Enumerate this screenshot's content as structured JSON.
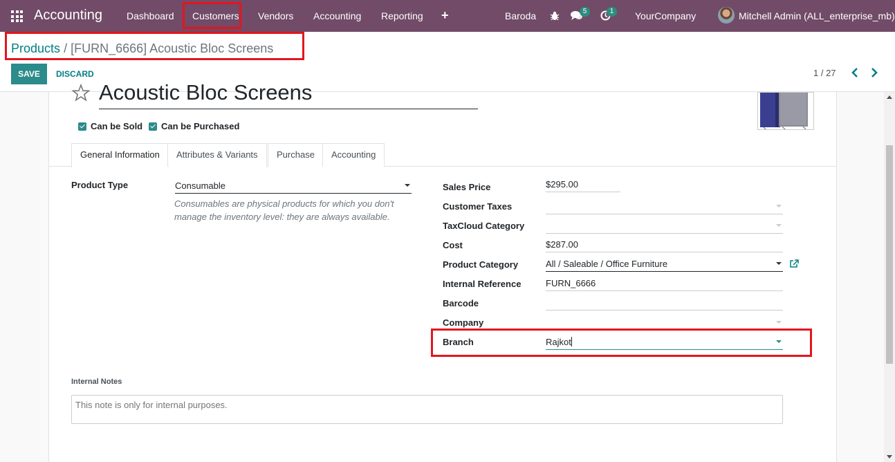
{
  "navbar": {
    "brand": "Accounting",
    "menu": [
      "Dashboard",
      "Customers",
      "Vendors",
      "Accounting",
      "Reporting"
    ],
    "branch": "Baroda",
    "messages_count": "5",
    "activities_count": "1",
    "company": "YourCompany",
    "user": "Mitchell Admin (ALL_enterprise_mb)"
  },
  "breadcrumb": {
    "parent": "Products",
    "separator": "/",
    "current": "[FURN_6666] Acoustic Bloc Screens"
  },
  "actions": {
    "save": "SAVE",
    "discard": "DISCARD"
  },
  "pager": {
    "value": "1 / 27"
  },
  "product": {
    "name": "Acoustic Bloc Screens",
    "can_be_sold": "Can be Sold",
    "can_be_purchased": "Can be Purchased"
  },
  "tabs": [
    "General Information",
    "Attributes & Variants",
    "Purchase",
    "Accounting"
  ],
  "general": {
    "product_type_label": "Product Type",
    "product_type_value": "Consumable",
    "product_type_help": "Consumables are physical products for which you don't manage the inventory level: they are always available.",
    "fields": {
      "sales_price": {
        "label": "Sales Price",
        "value": "$295.00"
      },
      "customer_taxes": {
        "label": "Customer Taxes",
        "value": ""
      },
      "taxcloud_category": {
        "label": "TaxCloud Category",
        "value": ""
      },
      "cost": {
        "label": "Cost",
        "value": "$287.00"
      },
      "product_category": {
        "label": "Product Category",
        "value": "All / Saleable / Office Furniture"
      },
      "internal_reference": {
        "label": "Internal Reference",
        "value": "FURN_6666"
      },
      "barcode": {
        "label": "Barcode",
        "value": ""
      },
      "company": {
        "label": "Company",
        "value": ""
      },
      "branch": {
        "label": "Branch",
        "value": "Rajkot"
      }
    }
  },
  "notes": {
    "label": "Internal Notes",
    "placeholder": "This note is only for internal purposes."
  },
  "colors": {
    "navbar": "#714b67",
    "accent": "#2c8b8b",
    "link": "#017e84",
    "highlight": "#e3151d"
  }
}
